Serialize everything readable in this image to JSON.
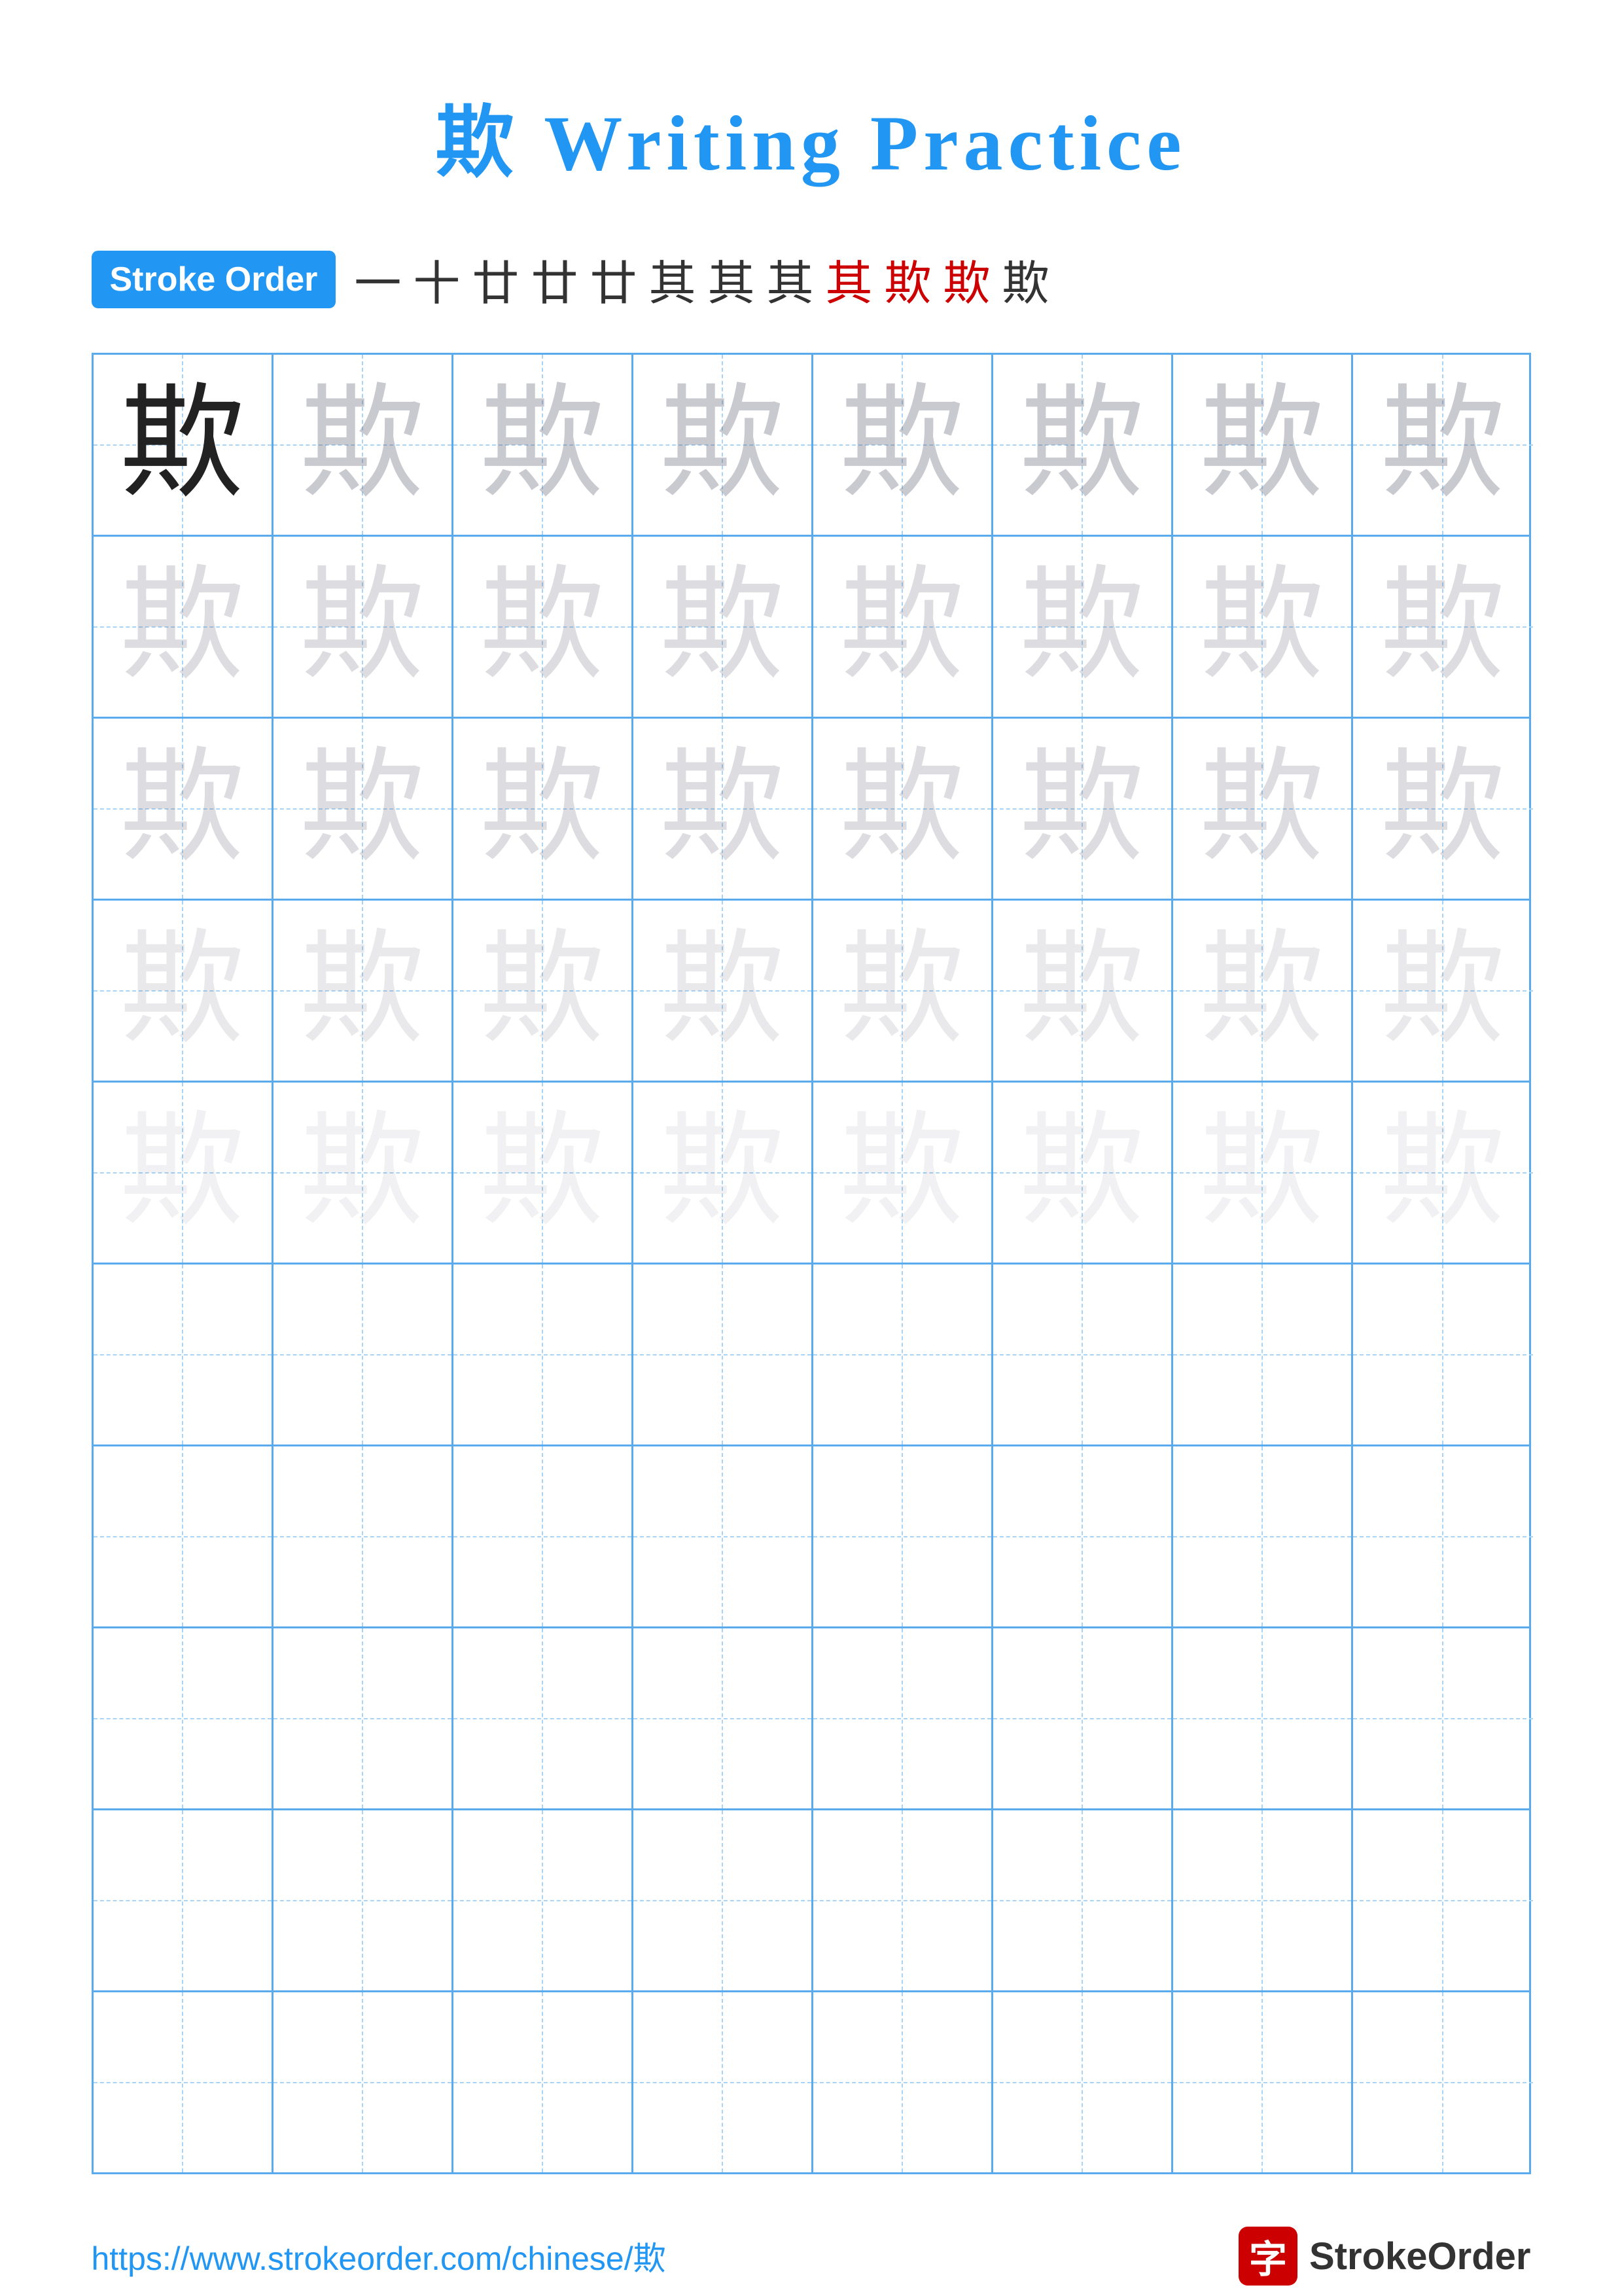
{
  "title": "欺 Writing Practice",
  "stroke_order": {
    "label": "Stroke Order",
    "chars": [
      {
        "c": "一",
        "red": false
      },
      {
        "c": "十",
        "red": false
      },
      {
        "c": "廿",
        "red": false
      },
      {
        "c": "廿",
        "red": false
      },
      {
        "c": "廿",
        "red": false
      },
      {
        "c": "其",
        "red": false
      },
      {
        "c": "其",
        "red": false
      },
      {
        "c": "其",
        "red": false
      },
      {
        "c": "其",
        "red": true
      },
      {
        "c": "欺",
        "red": true
      },
      {
        "c": "欺",
        "red": true
      },
      {
        "c": "欺",
        "red": false
      }
    ]
  },
  "main_char": "欺",
  "grid_rows": 10,
  "grid_cols": 8,
  "footer": {
    "url": "https://www.strokeorder.com/chinese/欺",
    "logo_char": "字",
    "logo_text": "StrokeOrder"
  }
}
